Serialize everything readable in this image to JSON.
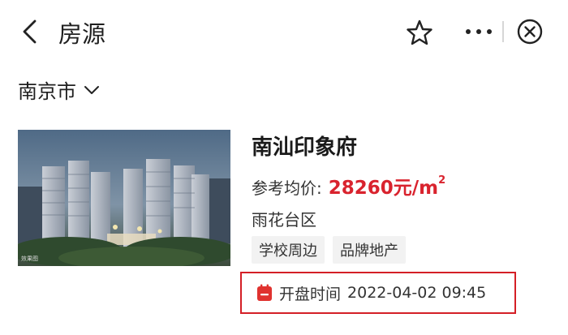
{
  "header": {
    "title": "房源",
    "back_icon": "chevron-left-icon",
    "favorite_icon": "star-outline-icon",
    "more_icon": "more-dots-icon",
    "close_icon": "close-circle-icon"
  },
  "location": {
    "city": "南京市",
    "dropdown_icon": "chevron-down-icon"
  },
  "listing": {
    "name": "南汕印象府",
    "price_label": "参考均价:",
    "price_value": "28260",
    "price_unit": "元/m",
    "price_unit_exp": "2",
    "district": "雨花台区",
    "tags": [
      "学校周边",
      "品牌地产"
    ],
    "photo_caption": "效果图",
    "open_time_icon": "calendar-icon",
    "open_time_label": "开盘时间",
    "open_time_value": "2022-04-02 09:45"
  },
  "colors": {
    "price": "#d9232e",
    "highlight_border": "#d41f26",
    "calendar_icon": "#e0322f",
    "tag_bg": "#f2f2f2"
  }
}
